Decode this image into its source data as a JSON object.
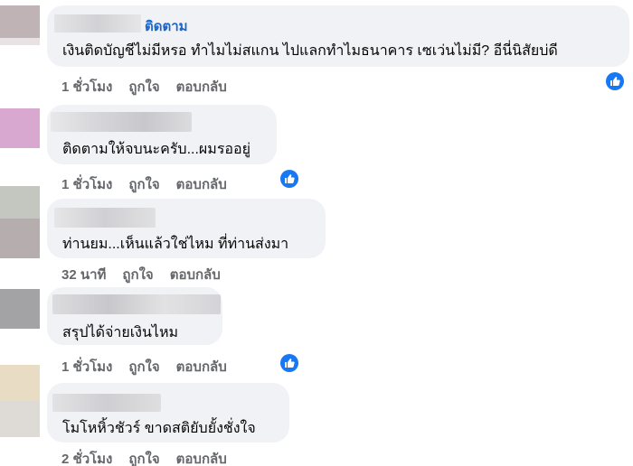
{
  "comments": [
    {
      "follow_label": "ติดตาม",
      "text": "เงินติดบัญชีไม่มีหรอ ทำไมไม่สแกน ไปแลกทำไมธนาคาร เซเว่นไม่มี? อีนี่นิสัยบ่ดี",
      "time": "1 ชั่วโมง",
      "like_label": "ถูกใจ",
      "reply_label": "ตอบกลับ"
    },
    {
      "text": "ติดตามให้จบนะครับ...ผมรออยู่",
      "time": "1 ชั่วโมง",
      "like_label": "ถูกใจ",
      "reply_label": "ตอบกลับ"
    },
    {
      "text": "ท่านยม...เห็นแล้วใช่ไหม ที่ท่านส่งมา",
      "time": "32 นาที",
      "like_label": "ถูกใจ",
      "reply_label": "ตอบกลับ"
    },
    {
      "text": "สรุปได้จ่ายเงินไหม",
      "time": "1 ชั่วโมง",
      "like_label": "ถูกใจ",
      "reply_label": "ตอบกลับ"
    },
    {
      "text": "โมโหหิ้วชัวร์ ขาดสติยับยั้งชั่งใจ",
      "time": "2 ชั่วโมง",
      "like_label": "ถูกใจ",
      "reply_label": "ตอบกลับ"
    }
  ],
  "icons": {
    "reaction": "like-reaction-icon"
  },
  "colors": {
    "bubble": "#f0f2f5",
    "follow": "#1a66cc",
    "meta": "#65676b",
    "like": "#1877f2"
  }
}
